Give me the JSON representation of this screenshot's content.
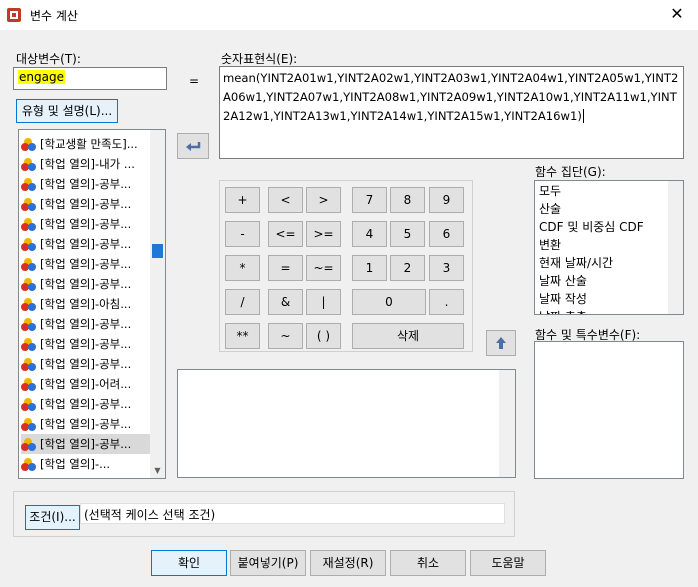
{
  "window": {
    "title": "변수 계산",
    "close_glyph": "✕"
  },
  "target": {
    "label": "대상변수(T):",
    "value": "engage"
  },
  "equals": "=",
  "expression": {
    "label": "숫자표현식(E):",
    "value": "mean(YINT2A01w1,YINT2A02w1,YINT2A03w1,YINT2A04w1,YINT2A05w1,YINT2A06w1,YINT2A07w1,YINT2A08w1,YINT2A09w1,YINT2A10w1,YINT2A11w1,YINT2A12w1,YINT2A13w1,YINT2A14w1,YINT2A15w1,YINT2A16w1)"
  },
  "type_label_button": "유형 및 설명(L)...",
  "variables": [
    "[학교생활 만족도]...",
    "[학업 열의]-내가 ...",
    "[학업 열의]-공부...",
    "[학업 열의]-공부...",
    "[학업 열의]-공부...",
    "[학업 열의]-공부...",
    "[학업 열의]-공부...",
    "[학업 열의]-공부...",
    "[학업 열의]-아침...",
    "[학업 열의]-공부...",
    "[학업 열의]-공부...",
    "[학업 열의]-공부...",
    "[학업 열의]-어려...",
    "[학업 열의]-공부...",
    "[학업 열의]-공부...",
    "[학업 열의]-공부...",
    "[학업 열의]-..."
  ],
  "selected_variable_index": 15,
  "keypad": {
    "plus": "+",
    "lt": "<",
    "gt": ">",
    "seven": "7",
    "eight": "8",
    "nine": "9",
    "minus": "-",
    "le": "<=",
    "ge": ">=",
    "four": "4",
    "five": "5",
    "six": "6",
    "mul": "*",
    "eq": "=",
    "ne": "~=",
    "one": "1",
    "two": "2",
    "three": "3",
    "div": "/",
    "and": "&",
    "or": "|",
    "zero": "0",
    "dot": ".",
    "pow": "**",
    "not": "~",
    "paren": "( )",
    "delete": "삭제"
  },
  "function_group": {
    "label": "함수 집단(G):",
    "items": [
      "모두",
      "산술",
      "CDF 및 비중심 CDF",
      "변환",
      "현재 날짜/시간",
      "날짜 산술",
      "날짜 작성",
      "날짜 추출"
    ]
  },
  "special_variables_label": "함수 및 특수변수(F):",
  "condition": {
    "button": "조건(I)...",
    "text": "(선택적 케이스 선택 조건)"
  },
  "buttons": {
    "ok": "확인",
    "paste": "붙여넣기(P)",
    "reset": "재설정(R)",
    "cancel": "취소",
    "help": "도움말"
  },
  "colors": {
    "accent": "#0078d7",
    "highlight": "#ffff00",
    "thumb": "#1e78d8"
  }
}
